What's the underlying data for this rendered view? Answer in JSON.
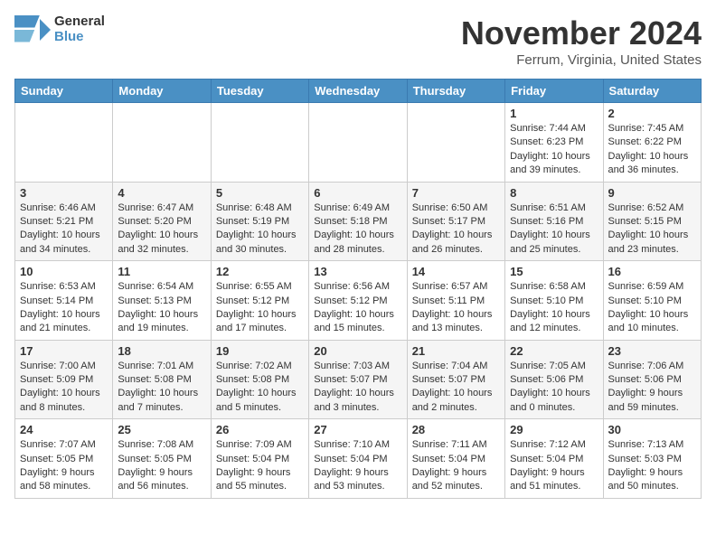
{
  "header": {
    "logo_line1": "General",
    "logo_line2": "Blue",
    "month": "November 2024",
    "location": "Ferrum, Virginia, United States"
  },
  "weekdays": [
    "Sunday",
    "Monday",
    "Tuesday",
    "Wednesday",
    "Thursday",
    "Friday",
    "Saturday"
  ],
  "weeks": [
    [
      {
        "day": "",
        "info": ""
      },
      {
        "day": "",
        "info": ""
      },
      {
        "day": "",
        "info": ""
      },
      {
        "day": "",
        "info": ""
      },
      {
        "day": "",
        "info": ""
      },
      {
        "day": "1",
        "info": "Sunrise: 7:44 AM\nSunset: 6:23 PM\nDaylight: 10 hours and 39 minutes."
      },
      {
        "day": "2",
        "info": "Sunrise: 7:45 AM\nSunset: 6:22 PM\nDaylight: 10 hours and 36 minutes."
      }
    ],
    [
      {
        "day": "3",
        "info": "Sunrise: 6:46 AM\nSunset: 5:21 PM\nDaylight: 10 hours and 34 minutes."
      },
      {
        "day": "4",
        "info": "Sunrise: 6:47 AM\nSunset: 5:20 PM\nDaylight: 10 hours and 32 minutes."
      },
      {
        "day": "5",
        "info": "Sunrise: 6:48 AM\nSunset: 5:19 PM\nDaylight: 10 hours and 30 minutes."
      },
      {
        "day": "6",
        "info": "Sunrise: 6:49 AM\nSunset: 5:18 PM\nDaylight: 10 hours and 28 minutes."
      },
      {
        "day": "7",
        "info": "Sunrise: 6:50 AM\nSunset: 5:17 PM\nDaylight: 10 hours and 26 minutes."
      },
      {
        "day": "8",
        "info": "Sunrise: 6:51 AM\nSunset: 5:16 PM\nDaylight: 10 hours and 25 minutes."
      },
      {
        "day": "9",
        "info": "Sunrise: 6:52 AM\nSunset: 5:15 PM\nDaylight: 10 hours and 23 minutes."
      }
    ],
    [
      {
        "day": "10",
        "info": "Sunrise: 6:53 AM\nSunset: 5:14 PM\nDaylight: 10 hours and 21 minutes."
      },
      {
        "day": "11",
        "info": "Sunrise: 6:54 AM\nSunset: 5:13 PM\nDaylight: 10 hours and 19 minutes."
      },
      {
        "day": "12",
        "info": "Sunrise: 6:55 AM\nSunset: 5:12 PM\nDaylight: 10 hours and 17 minutes."
      },
      {
        "day": "13",
        "info": "Sunrise: 6:56 AM\nSunset: 5:12 PM\nDaylight: 10 hours and 15 minutes."
      },
      {
        "day": "14",
        "info": "Sunrise: 6:57 AM\nSunset: 5:11 PM\nDaylight: 10 hours and 13 minutes."
      },
      {
        "day": "15",
        "info": "Sunrise: 6:58 AM\nSunset: 5:10 PM\nDaylight: 10 hours and 12 minutes."
      },
      {
        "day": "16",
        "info": "Sunrise: 6:59 AM\nSunset: 5:10 PM\nDaylight: 10 hours and 10 minutes."
      }
    ],
    [
      {
        "day": "17",
        "info": "Sunrise: 7:00 AM\nSunset: 5:09 PM\nDaylight: 10 hours and 8 minutes."
      },
      {
        "day": "18",
        "info": "Sunrise: 7:01 AM\nSunset: 5:08 PM\nDaylight: 10 hours and 7 minutes."
      },
      {
        "day": "19",
        "info": "Sunrise: 7:02 AM\nSunset: 5:08 PM\nDaylight: 10 hours and 5 minutes."
      },
      {
        "day": "20",
        "info": "Sunrise: 7:03 AM\nSunset: 5:07 PM\nDaylight: 10 hours and 3 minutes."
      },
      {
        "day": "21",
        "info": "Sunrise: 7:04 AM\nSunset: 5:07 PM\nDaylight: 10 hours and 2 minutes."
      },
      {
        "day": "22",
        "info": "Sunrise: 7:05 AM\nSunset: 5:06 PM\nDaylight: 10 hours and 0 minutes."
      },
      {
        "day": "23",
        "info": "Sunrise: 7:06 AM\nSunset: 5:06 PM\nDaylight: 9 hours and 59 minutes."
      }
    ],
    [
      {
        "day": "24",
        "info": "Sunrise: 7:07 AM\nSunset: 5:05 PM\nDaylight: 9 hours and 58 minutes."
      },
      {
        "day": "25",
        "info": "Sunrise: 7:08 AM\nSunset: 5:05 PM\nDaylight: 9 hours and 56 minutes."
      },
      {
        "day": "26",
        "info": "Sunrise: 7:09 AM\nSunset: 5:04 PM\nDaylight: 9 hours and 55 minutes."
      },
      {
        "day": "27",
        "info": "Sunrise: 7:10 AM\nSunset: 5:04 PM\nDaylight: 9 hours and 53 minutes."
      },
      {
        "day": "28",
        "info": "Sunrise: 7:11 AM\nSunset: 5:04 PM\nDaylight: 9 hours and 52 minutes."
      },
      {
        "day": "29",
        "info": "Sunrise: 7:12 AM\nSunset: 5:04 PM\nDaylight: 9 hours and 51 minutes."
      },
      {
        "day": "30",
        "info": "Sunrise: 7:13 AM\nSunset: 5:03 PM\nDaylight: 9 hours and 50 minutes."
      }
    ]
  ]
}
